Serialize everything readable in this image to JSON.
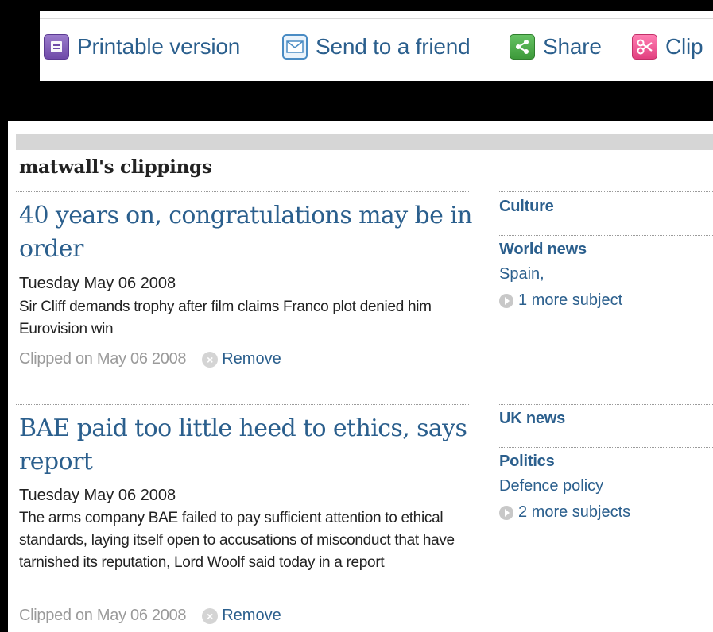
{
  "toolbar": {
    "items": [
      {
        "label": "Printable version",
        "icon": "print-icon"
      },
      {
        "label": "Send to a friend",
        "icon": "mail-icon"
      },
      {
        "label": "Share",
        "icon": "share-icon"
      },
      {
        "label": "Clip",
        "icon": "scissors-icon"
      }
    ]
  },
  "clippings": {
    "title": "matwall's clippings",
    "items": [
      {
        "headline": "40 years on, congratulations may be in order",
        "date": "Tuesday May 06 2008",
        "summary": "Sir Cliff demands trophy after film claims Franco plot denied him Eurovision win",
        "clipped": "Clipped on May 06 2008",
        "remove": "Remove",
        "tags": [
          {
            "head": "Culture"
          },
          {
            "head": "World news",
            "subs": [
              "Spain,"
            ],
            "more": "1 more subject"
          }
        ]
      },
      {
        "headline": "BAE paid too little heed to ethics, says report",
        "date": "Tuesday May 06 2008",
        "summary": "The arms company BAE failed to pay sufficient attention to ethical standards, laying itself open to accusations of misconduct that have tarnished its reputation, Lord Woolf said today in a report",
        "clipped": "Clipped on May 06 2008",
        "remove": "Remove",
        "tags": [
          {
            "head": "UK news"
          },
          {
            "head": "Politics",
            "subs": [
              "Defence policy"
            ],
            "more": "2 more subjects"
          }
        ]
      }
    ]
  },
  "colors": {
    "link": "#2b5f8d",
    "muted": "#9a9a9a",
    "text": "#222222"
  }
}
